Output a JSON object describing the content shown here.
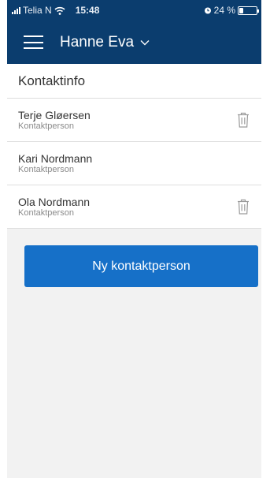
{
  "status_bar": {
    "carrier": "Telia N",
    "time": "15:48",
    "battery_text": "24 %",
    "battery_level": 0.24
  },
  "header": {
    "user_name": "Hanne Eva"
  },
  "section": {
    "title": "Kontaktinfo"
  },
  "contacts": [
    {
      "name": "Terje Gløersen",
      "role": "Kontaktperson",
      "deletable": true
    },
    {
      "name": "Kari Nordmann",
      "role": "Kontaktperson",
      "deletable": false
    },
    {
      "name": "Ola Nordmann",
      "role": "Kontaktperson",
      "deletable": true
    }
  ],
  "actions": {
    "new_contact_label": "Ny kontaktperson"
  },
  "colors": {
    "header_bg": "#0b3d6e",
    "accent": "#1670c8",
    "background": "#f2f2f2"
  },
  "icons": [
    "signal-icon",
    "wifi-icon",
    "alarm-icon",
    "battery-icon",
    "hamburger-menu-icon",
    "chevron-down-icon",
    "trash-icon"
  ]
}
